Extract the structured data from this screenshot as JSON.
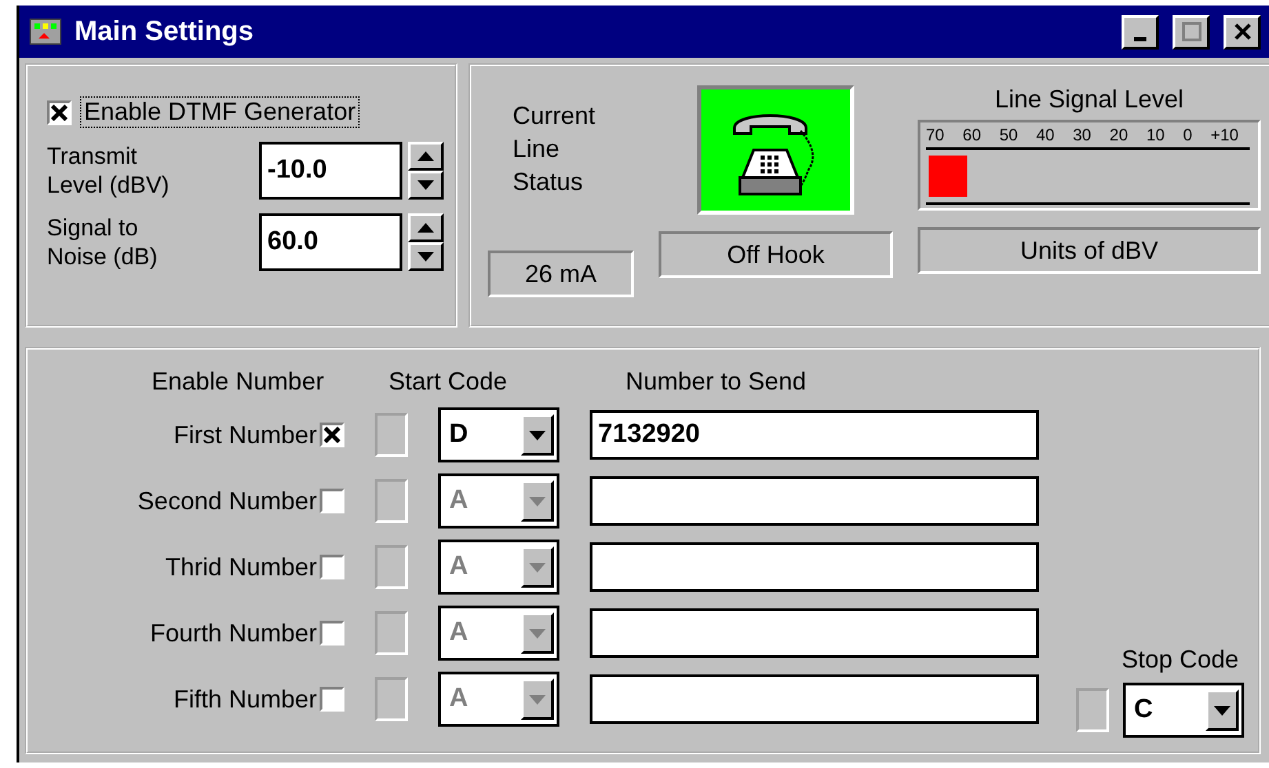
{
  "window": {
    "title": "Main Settings",
    "buttons": [
      {
        "kind": "minimize"
      },
      {
        "kind": "maximize"
      },
      {
        "kind": "close"
      }
    ]
  },
  "generator": {
    "enable": {
      "label": "Enable DTMF Generator",
      "checked": true
    },
    "fields": [
      {
        "label": "Transmit Level (dBV)",
        "value": "-10.0"
      },
      {
        "label": "Signal to Noise (dB)",
        "value": "60.0"
      }
    ]
  },
  "line": {
    "status_label": "Current Line Status",
    "current": "26 mA",
    "hook_status": "Off Hook",
    "off_hook": true,
    "meter": {
      "title": "Line Signal Level",
      "ticks": [
        "70",
        "60",
        "50",
        "40",
        "30",
        "20",
        "10",
        "0",
        "+10"
      ],
      "level": 0.12,
      "units": "Units of dBV"
    }
  },
  "numbers": {
    "headers": [
      "Enable Number",
      "Start Code",
      "Number to Send"
    ],
    "rows": [
      {
        "label": "First Number",
        "checked": true,
        "lit": false,
        "start_code": "D",
        "value": "7132920"
      },
      {
        "label": "Second Number",
        "checked": false,
        "lit": false,
        "start_code": "A",
        "value": ""
      },
      {
        "label": "Thrid Number",
        "checked": false,
        "lit": false,
        "start_code": "A",
        "value": ""
      },
      {
        "label": "Fourth Number",
        "checked": false,
        "lit": false,
        "start_code": "A",
        "value": ""
      },
      {
        "label": "Fifth Number",
        "checked": false,
        "lit": false,
        "start_code": "A",
        "value": ""
      }
    ],
    "stop": {
      "label": "Stop Code",
      "lit": false,
      "code": "C"
    }
  }
}
